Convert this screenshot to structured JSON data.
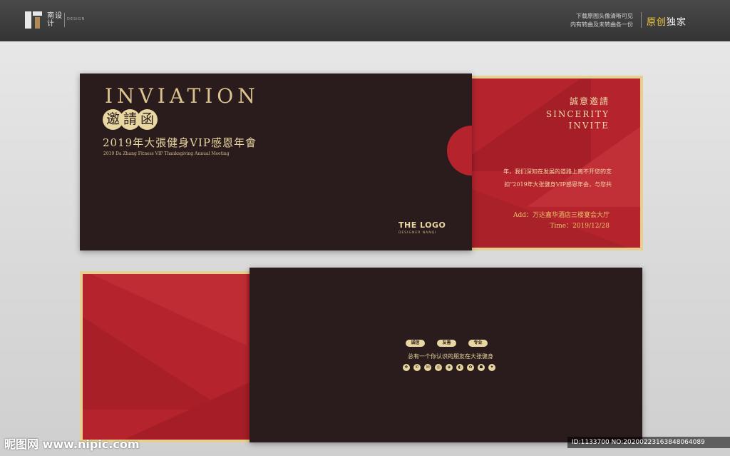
{
  "header": {
    "brand_cn": "南设计",
    "brand_en": "DESIGN",
    "note_line1": "下载原图头像清晰可见",
    "note_line2": "内有转曲及未转曲各一份",
    "original_part1": "原创",
    "original_part2": "独家"
  },
  "card_front": {
    "title": "INVIATION",
    "seal_chars": [
      "邀",
      "請",
      "函"
    ],
    "event_cn": "2019年大張健身VIP感恩年會",
    "event_en": "2019 Da Zhang Fitness VIP Thanksgiving Annual Meeting",
    "logo": "THE LOGO",
    "logo_sub": "DESIGNER NANQI"
  },
  "card_inner": {
    "sincere_cn": "誠意邀請",
    "sincere_en_1": "SINCERITY",
    "sincere_en_2": "INVITE",
    "body_line1": "年，我们深知在发展的道路上离不开您的支",
    "body_line2": "扣”2019年大张健身VIP感恩年会，与您共",
    "address": "Add：万达嘉华酒店三楼宴会大厅",
    "time": "Time：2019/12/28"
  },
  "card_back": {
    "tags": [
      "诚信",
      "友善",
      "专业"
    ],
    "slogan": "总有一个你认识的朋友在大张健身",
    "icons": [
      "❖",
      "✆",
      "✉",
      "◎",
      "◈",
      "◐",
      "✿",
      "☗",
      "✦"
    ]
  },
  "watermark": {
    "site": "昵图网 www.nipic.com",
    "id_text": "ID:1133700 NO:20200223163848064089"
  },
  "colors": {
    "dark": "#2a1c1c",
    "red": "#b5242d",
    "gold": "#e9d7a1",
    "border_gold": "#e7cf91"
  }
}
